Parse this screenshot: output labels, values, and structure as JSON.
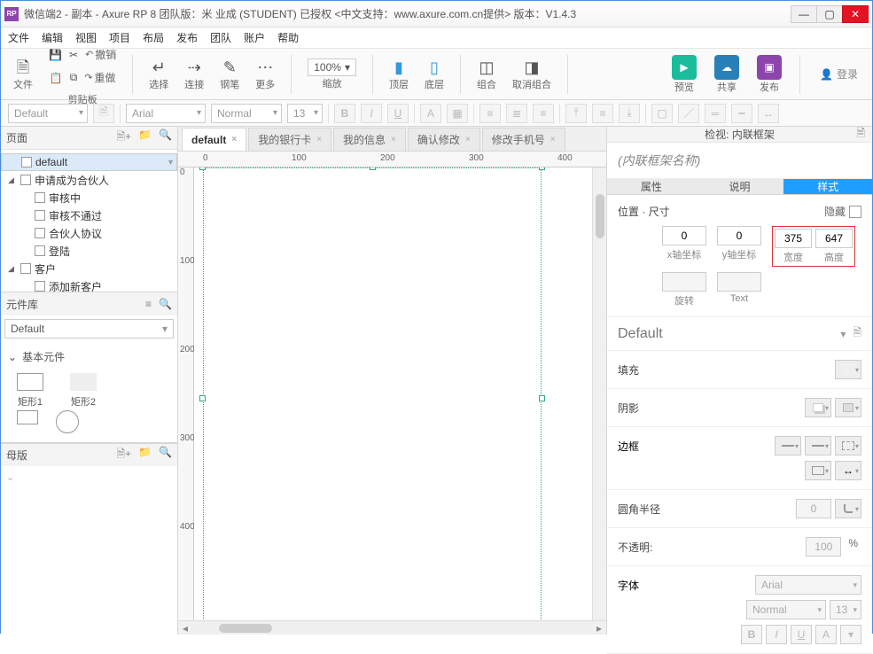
{
  "titlebar": {
    "app_badge": "RP",
    "title": "微信端2 - 副本 - Axure RP 8 团队版：米 业成 (STUDENT) 已授权    <中文支持：www.axure.com.cn提供> 版本：V1.4.3"
  },
  "menubar": [
    "文件",
    "编辑",
    "视图",
    "项目",
    "布局",
    "发布",
    "团队",
    "账户",
    "帮助"
  ],
  "toolbar": {
    "file": "文件",
    "clipboard": "剪贴板",
    "cut": "剪切",
    "copy": "复制",
    "paste": "粘贴",
    "undo": "撤销",
    "redo": "重做",
    "select": "选择",
    "connect": "连接",
    "pen": "钢笔",
    "more": "更多",
    "zoom_val": "100%",
    "zoom_lbl": "缩放",
    "top": "顶层",
    "bottom": "底层",
    "group": "组合",
    "ungroup": "取消组合",
    "preview": "预览",
    "share": "共享",
    "publish": "发布",
    "login": "登录"
  },
  "fmt": {
    "style": "Default",
    "font": "Arial",
    "weight": "Normal",
    "size": "13"
  },
  "left": {
    "pages_hdr": "页面",
    "tree": [
      {
        "label": "default",
        "indent": 0,
        "arrow": "",
        "sel": true
      },
      {
        "label": "申请成为合伙人",
        "indent": 0,
        "arrow": "▢"
      },
      {
        "label": "审核中",
        "indent": 1,
        "arrow": ""
      },
      {
        "label": "审核不通过",
        "indent": 1,
        "arrow": ""
      },
      {
        "label": "合伙人协议",
        "indent": 1,
        "arrow": ""
      },
      {
        "label": "登陆",
        "indent": 1,
        "arrow": ""
      },
      {
        "label": "客户",
        "indent": 0,
        "arrow": "▢"
      },
      {
        "label": "添加新客户",
        "indent": 1,
        "arrow": ""
      }
    ],
    "lib_hdr": "元件库",
    "lib_sel": "Default",
    "lib_cat": "基本元件",
    "shape1": "矩形1",
    "shape2": "矩形2",
    "master_hdr": "母版"
  },
  "tabs": [
    {
      "label": "default",
      "active": true
    },
    {
      "label": "我的银行卡",
      "active": false
    },
    {
      "label": "我的信息",
      "active": false
    },
    {
      "label": "确认修改",
      "active": false
    },
    {
      "label": "修改手机号",
      "active": false
    }
  ],
  "rulerH": [
    "0",
    "100",
    "200",
    "300",
    "400"
  ],
  "rulerV": [
    "0",
    "100",
    "200",
    "300",
    "400"
  ],
  "right": {
    "hdr": "检视: 内联框架",
    "name_placeholder": "(内联框架名称)",
    "tabs": [
      "属性",
      "说明",
      "样式"
    ],
    "active_tab": 2,
    "pos_size": "位置 · 尺寸",
    "hide": "隐藏",
    "x_val": "0",
    "x_lbl": "x轴坐标",
    "y_val": "0",
    "y_lbl": "y轴坐标",
    "w_val": "375",
    "w_lbl": "宽度",
    "h_val": "647",
    "h_lbl": "高度",
    "rotate": "旋转",
    "text": "Text",
    "default_style": "Default",
    "fill": "填充",
    "shadow": "阴影",
    "border": "边框",
    "corner": "圆角半径",
    "corner_val": "0",
    "opacity": "不透明:",
    "opacity_val": "100",
    "opacity_unit": "%",
    "font_lbl": "字体",
    "font_name": "Arial",
    "font_weight": "Normal",
    "font_size": "13"
  }
}
